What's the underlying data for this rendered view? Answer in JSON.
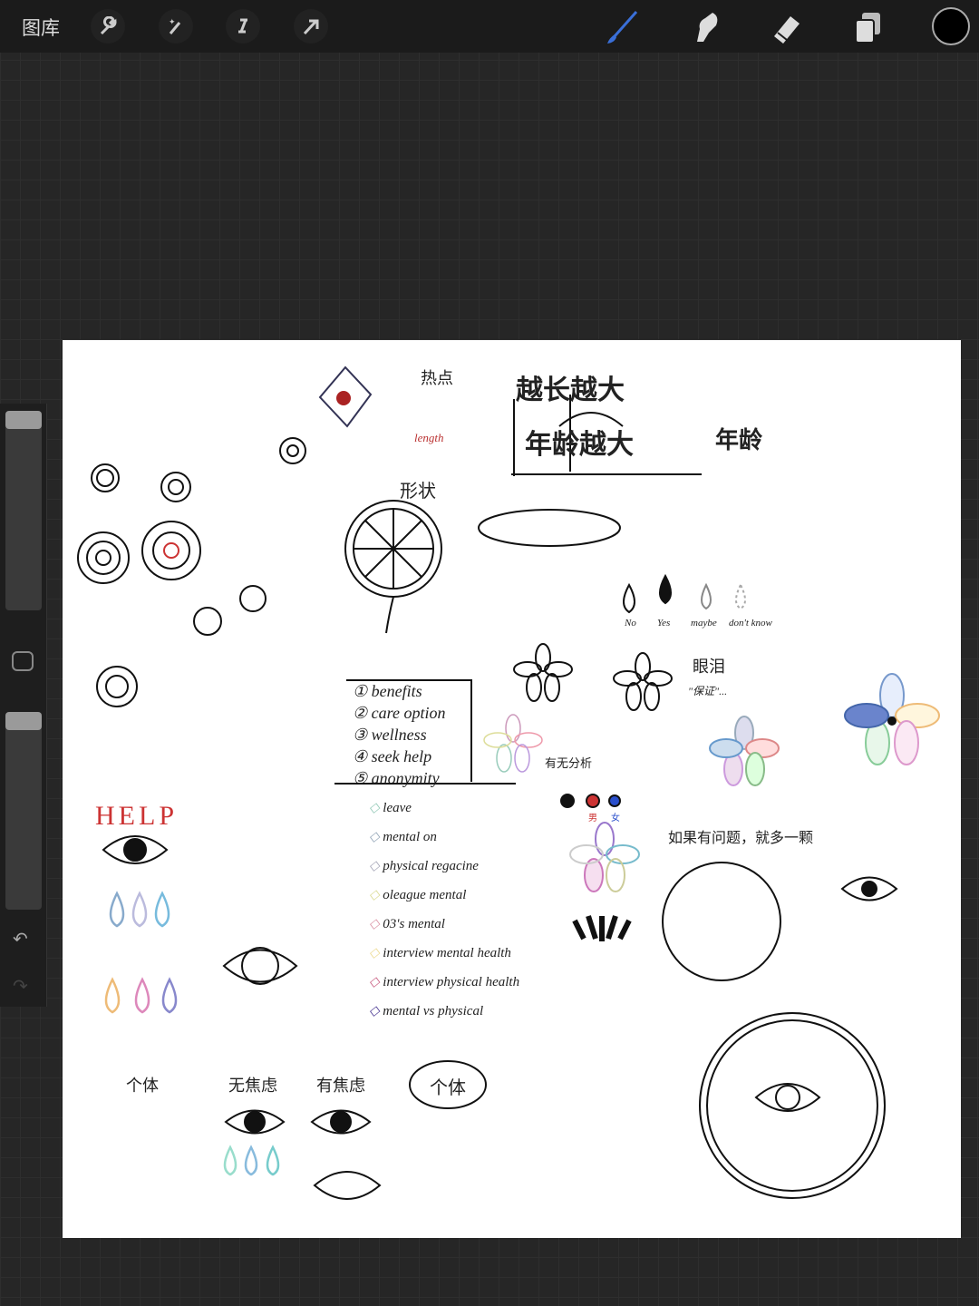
{
  "topbar": {
    "gallery_label": "图库",
    "left_tools": [
      "wrench-icon",
      "magic-wand-icon",
      "selection-icon",
      "transform-arrow-icon"
    ],
    "right_tools": [
      "brush-icon",
      "smudge-icon",
      "eraser-icon",
      "layers-icon"
    ],
    "active_tool": "brush",
    "brush_color": "#3a6fd8",
    "current_color": "#000000"
  },
  "sidebar": {
    "brush_size": 1.0,
    "opacity": 1.0,
    "undo": "↶",
    "redo": "↷"
  },
  "canvas": {
    "title_notes": [
      "越长越大",
      "年龄越大",
      "年龄"
    ],
    "hot_label": "热点",
    "length_label": "length",
    "top_label": "形状",
    "list": [
      "① benefits",
      "② care option",
      "③ wellness",
      "④ seek help",
      "⑤ anonymity"
    ],
    "legend": [
      "leave",
      "mental on",
      "physical regacine",
      "oleague mental",
      "03's mental",
      "interview mental health",
      "interview physical health",
      "mental vs physical"
    ],
    "answers": [
      "No",
      "Yes",
      "maybe",
      "don't know"
    ],
    "tears": "眼泪",
    "tears_sub": "\"保证\"...",
    "help": "HELP",
    "individual": "个体",
    "individual2": "个体",
    "no_anxiety": "无焦虑",
    "anxiety": "有焦虑",
    "if_problem": "如果有问题，就多一颗",
    "info": "有无分析",
    "color_keys": [
      "男",
      "女"
    ]
  }
}
